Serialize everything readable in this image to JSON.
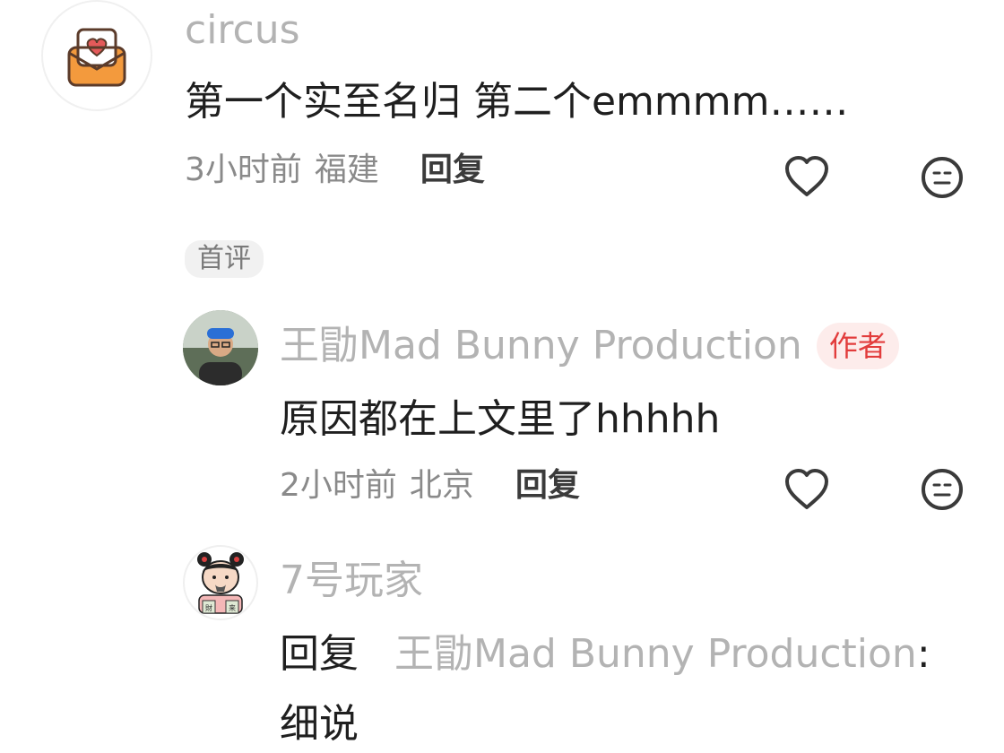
{
  "comments": [
    {
      "username": "circus",
      "text": "第一个实至名归 第二个emmmm……",
      "time": "3小时前",
      "location": "福建",
      "reply_label": "回复",
      "tag": "首评"
    },
    {
      "username": "王勖Mad Bunny Production",
      "badge": "作者",
      "text": "原因都在上文里了hhhhh",
      "time": "2小时前",
      "location": "北京",
      "reply_label": "回复"
    },
    {
      "username": "7号玩家",
      "reply_prefix": "回复",
      "reply_to": "王勖Mad Bunny Production",
      "reply_colon": ":",
      "text": "细说",
      "avatar_text_left": "財",
      "avatar_text_right": "来"
    }
  ],
  "colors": {
    "username": "#b3b3b3",
    "content": "#1f1f1f",
    "badge_text": "#e23c3c",
    "badge_bg": "#fdeceb",
    "mail_icon": "#f39a3d"
  },
  "icons": [
    "mail-heart-icon",
    "heart-icon",
    "neutral-face-icon"
  ]
}
